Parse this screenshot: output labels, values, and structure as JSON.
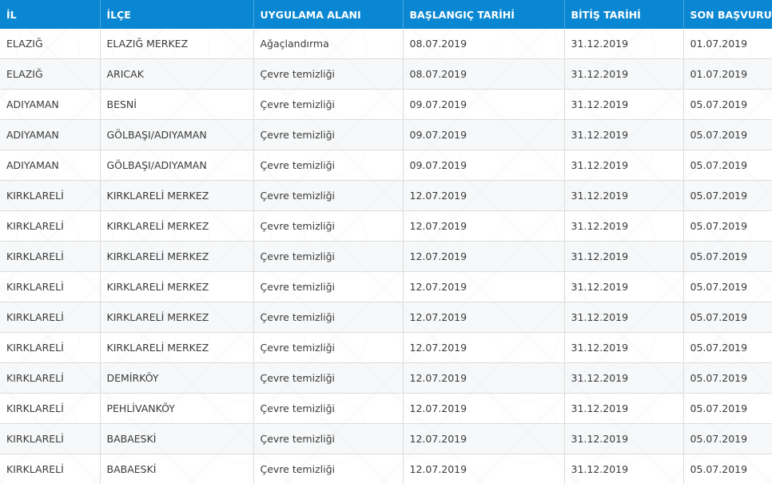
{
  "table": {
    "headers": [
      "İL",
      "İLÇE",
      "UYGULAMA ALANI",
      "BAŞLANGIÇ TARİHİ",
      "BİTİŞ TARİHİ",
      "SON BAŞVURU"
    ],
    "rows": [
      [
        "ELAZIĞ",
        "ELAZIĞ MERKEZ",
        "Ağaçlandırma",
        "08.07.2019",
        "31.12.2019",
        "01.07.2019"
      ],
      [
        "ELAZIĞ",
        "ARICAK",
        "Çevre temizliği",
        "08.07.2019",
        "31.12.2019",
        "01.07.2019"
      ],
      [
        "ADIYAMAN",
        "BESNİ",
        "Çevre temizliği",
        "09.07.2019",
        "31.12.2019",
        "05.07.2019"
      ],
      [
        "ADIYAMAN",
        "GÖLBAŞI/ADIYAMAN",
        "Çevre temizliği",
        "09.07.2019",
        "31.12.2019",
        "05.07.2019"
      ],
      [
        "ADIYAMAN",
        "GÖLBAŞI/ADIYAMAN",
        "Çevre temizliği",
        "09.07.2019",
        "31.12.2019",
        "05.07.2019"
      ],
      [
        "KIRKLARELİ",
        "KIRKLARELİ MERKEZ",
        "Çevre temizliği",
        "12.07.2019",
        "31.12.2019",
        "05.07.2019"
      ],
      [
        "KIRKLARELİ",
        "KIRKLARELİ MERKEZ",
        "Çevre temizliği",
        "12.07.2019",
        "31.12.2019",
        "05.07.2019"
      ],
      [
        "KIRKLARELİ",
        "KIRKLARELİ MERKEZ",
        "Çevre temizliği",
        "12.07.2019",
        "31.12.2019",
        "05.07.2019"
      ],
      [
        "KIRKLARELİ",
        "KIRKLARELİ MERKEZ",
        "Çevre temizliği",
        "12.07.2019",
        "31.12.2019",
        "05.07.2019"
      ],
      [
        "KIRKLARELİ",
        "KIRKLARELİ MERKEZ",
        "Çevre temizliği",
        "12.07.2019",
        "31.12.2019",
        "05.07.2019"
      ],
      [
        "KIRKLARELİ",
        "KIRKLARELİ MERKEZ",
        "Çevre temizliği",
        "12.07.2019",
        "31.12.2019",
        "05.07.2019"
      ],
      [
        "KIRKLARELİ",
        "DEMİRKÖY",
        "Çevre temizliği",
        "12.07.2019",
        "31.12.2019",
        "05.07.2019"
      ],
      [
        "KIRKLARELİ",
        "PEHLİVANKÖY",
        "Çevre temizliği",
        "12.07.2019",
        "31.12.2019",
        "05.07.2019"
      ],
      [
        "KIRKLARELİ",
        "BABAESKİ",
        "Çevre temizliği",
        "12.07.2019",
        "31.12.2019",
        "05.07.2019"
      ],
      [
        "KIRKLARELİ",
        "BABAESKİ",
        "Çevre temizliği",
        "12.07.2019",
        "31.12.2019",
        "05.07.2019"
      ]
    ]
  },
  "colors": {
    "header_background": "#0a87d2",
    "header_text": "#ffffff",
    "row_text": "#3a3a3a",
    "grid_line": "#dcdcdc"
  }
}
